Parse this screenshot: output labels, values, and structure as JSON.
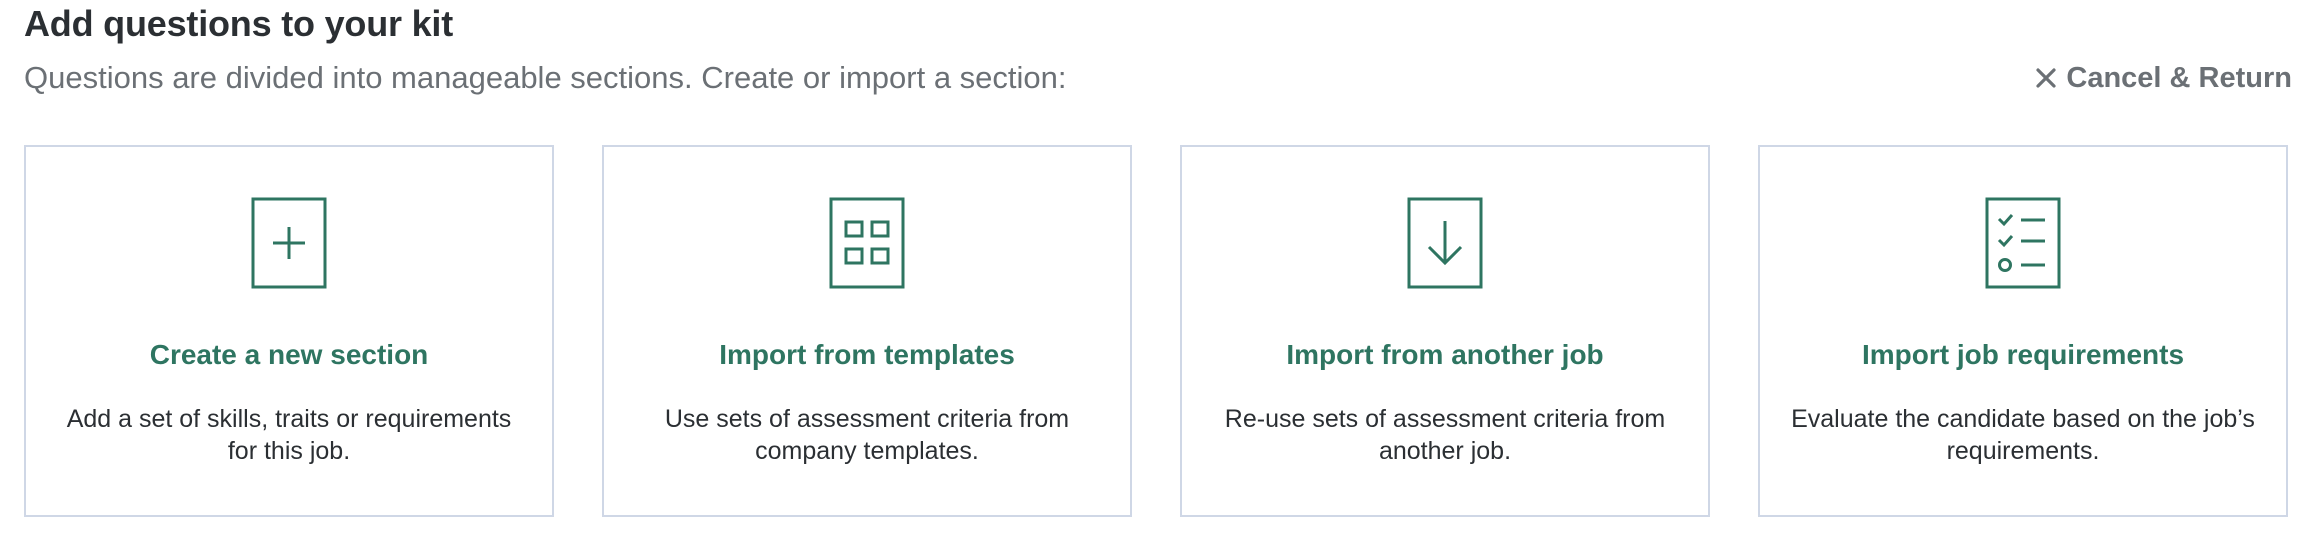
{
  "header": {
    "title": "Add questions to your kit",
    "subtitle": "Questions are divided into manageable sections. Create or import a section:",
    "cancel_label": "Cancel & Return",
    "cancel_icon": "close-icon"
  },
  "colors": {
    "accent": "#2e7561",
    "heading": "#2b2f33",
    "muted": "#6b7075",
    "card_border": "#cfd7e6"
  },
  "cards": [
    {
      "icon": "plus-box-icon",
      "title": "Create a new section",
      "description": "Add a set of skills, traits or requirements for this job."
    },
    {
      "icon": "template-grid-icon",
      "title": "Import from templates",
      "description": "Use sets of assessment criteria from company templates."
    },
    {
      "icon": "download-arrow-icon",
      "title": "Import from another job",
      "description": "Re-use sets of assessment criteria from another job."
    },
    {
      "icon": "checklist-icon",
      "title": "Import job requirements",
      "description": "Evaluate the candidate based on the job’s requirements."
    }
  ]
}
